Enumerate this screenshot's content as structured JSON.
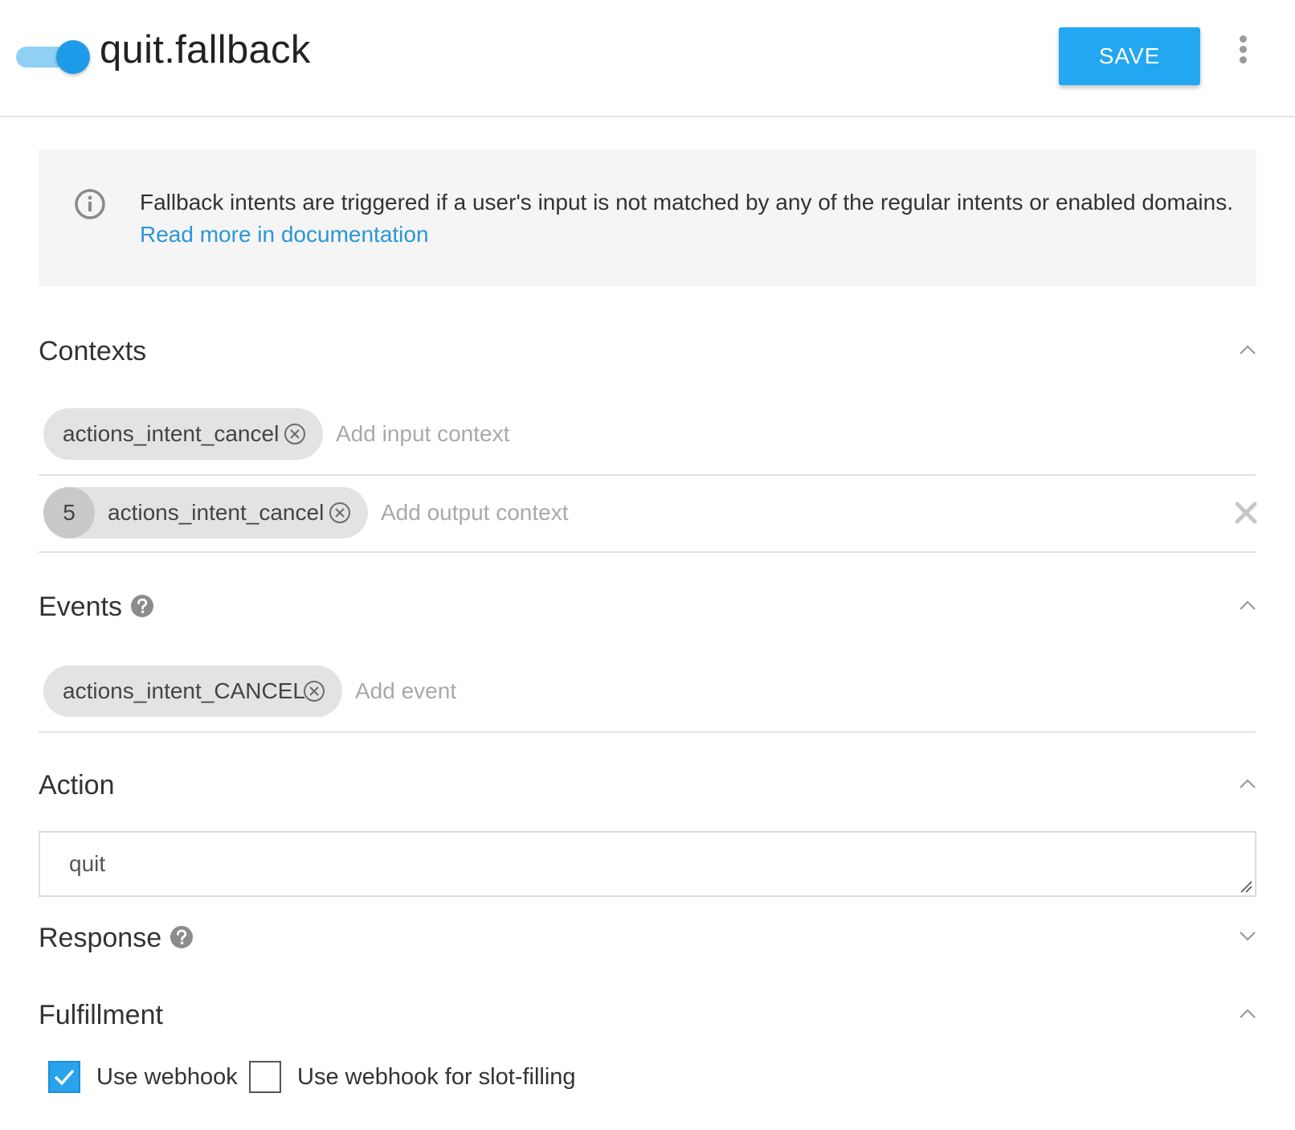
{
  "header": {
    "intent_name": "quit.fallback",
    "enabled": true,
    "save_label": "SAVE"
  },
  "info": {
    "text": "Fallback intents are triggered if a user's input is not matched by any of the regular intents or enabled domains.",
    "link_text": "Read more in documentation"
  },
  "contexts": {
    "title": "Contexts",
    "input": {
      "chips": [
        {
          "label": "actions_intent_cancel"
        }
      ],
      "placeholder": "Add input context"
    },
    "output": {
      "chips": [
        {
          "lifespan": "5",
          "label": "actions_intent_cancel"
        }
      ],
      "placeholder": "Add output context"
    }
  },
  "events": {
    "title": "Events",
    "chips": [
      {
        "label": "actions_intent_CANCEL"
      }
    ],
    "placeholder": "Add event"
  },
  "action": {
    "title": "Action",
    "value": "quit"
  },
  "response": {
    "title": "Response"
  },
  "fulfillment": {
    "title": "Fulfillment",
    "use_webhook": {
      "label": "Use webhook",
      "checked": true
    },
    "use_webhook_slot_filling": {
      "label": "Use webhook for slot-filling",
      "checked": false
    }
  },
  "colors": {
    "accent": "#22a7f0",
    "toggle_knob": "#1e9be8",
    "link": "#2b96d6",
    "chip_bg": "#e3e3e3",
    "info_bg": "#f5f5f5"
  },
  "icons": {
    "info": "info-circle-icon",
    "help": "question-circle-icon",
    "chip_remove": "close-circle-icon",
    "row_clear": "close-x-icon",
    "expand": "chevron-up-icon",
    "collapse": "chevron-down-icon",
    "menu": "more-vert-icon"
  }
}
